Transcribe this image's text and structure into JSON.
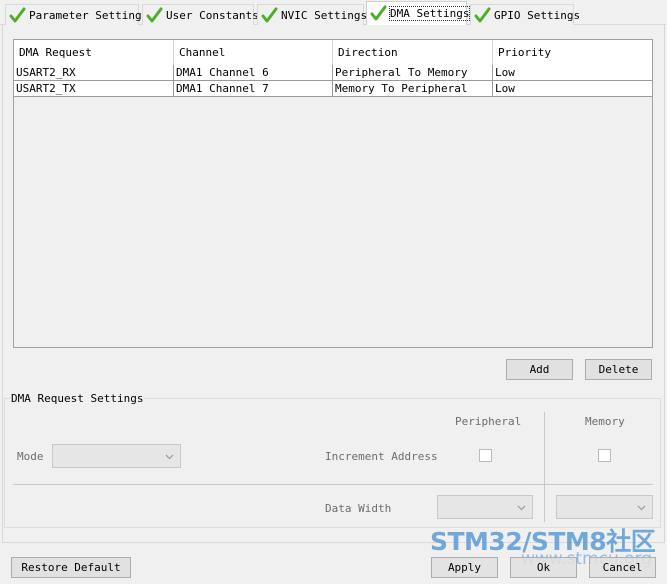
{
  "tabs": [
    {
      "label": "Parameter Settings",
      "active": false
    },
    {
      "label": "User Constants",
      "active": false
    },
    {
      "label": "NVIC Settings",
      "active": false
    },
    {
      "label": "DMA Settings",
      "active": true
    },
    {
      "label": "GPIO Settings",
      "active": false
    }
  ],
  "table": {
    "columns": [
      "DMA Request",
      "Channel",
      "Direction",
      "Priority"
    ],
    "rows": [
      [
        "USART2_RX",
        "DMA1 Channel 6",
        "Peripheral To Memory",
        "Low"
      ],
      [
        "USART2_TX",
        "DMA1 Channel 7",
        "Memory To Peripheral",
        "Low"
      ]
    ]
  },
  "buttons": {
    "add": "Add",
    "delete": "Delete",
    "restore": "Restore Default",
    "apply": "Apply",
    "ok": "Ok",
    "cancel": "Cancel"
  },
  "settings": {
    "title": "DMA Request Settings",
    "peripheral_header": "Peripheral",
    "memory_header": "Memory",
    "mode_label": "Mode",
    "mode_value": "",
    "increment_label": "Increment Address",
    "data_width_label": "Data Width",
    "periph_width_value": "",
    "memory_width_value": ""
  },
  "watermark": {
    "line1": "STM32/STM8社区",
    "line2": "www.stmcu.org"
  },
  "colors": {
    "check": "#4caf2a",
    "watermark": "#5b9bd5"
  }
}
